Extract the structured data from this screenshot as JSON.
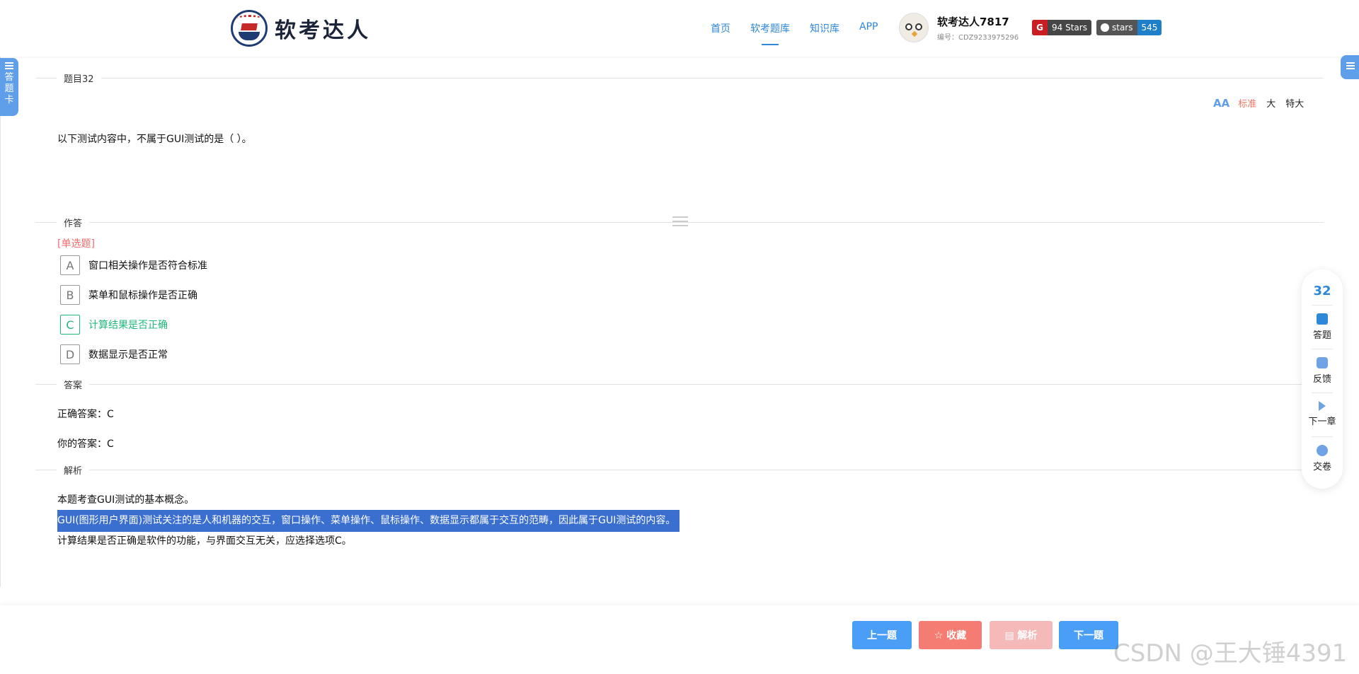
{
  "header": {
    "logo_text": "软考达人",
    "nav": [
      "首页",
      "软考题库",
      "知识库",
      "APP"
    ],
    "active_nav": "软考题库",
    "user_name": "软考达人7817",
    "user_id": "编号：CDZ9233975296",
    "gitee_badge": "94 Stars",
    "github_label": "stars",
    "github_count": "545"
  },
  "left_tab": {
    "label": "答题卡"
  },
  "question": {
    "section_label": "题目32",
    "font_sizes": [
      "标准",
      "大",
      "特大"
    ],
    "active_font_size": "标准",
    "text": "以下测试内容中，不属于GUI测试的是（ ）。"
  },
  "answer_section": {
    "label": "作答",
    "type": "[单选题]",
    "options": [
      {
        "key": "A",
        "text": "窗口相关操作是否符合标准"
      },
      {
        "key": "B",
        "text": "菜单和鼠标操作是否正确"
      },
      {
        "key": "C",
        "text": "计算结果是否正确"
      },
      {
        "key": "D",
        "text": "数据显示是否正常"
      }
    ]
  },
  "result_section": {
    "label": "答案",
    "correct": "正确答案：C",
    "yours": "你的答案：C"
  },
  "analysis_section": {
    "label": "解析",
    "lines": [
      "本题考查GUI测试的基本概念。",
      "GUI(图形用户界面)测试关注的是人和机器的交互，窗口操作、菜单操作、鼠标操作、数据显示都属于交互的范畴，因此属于GUI测试的内容。",
      "计算结果是否正确是软件的功能，与界面交互无关，应选择选项C。"
    ]
  },
  "float_panel": {
    "number": "32",
    "items": [
      "答题",
      "反馈",
      "下一章",
      "交卷"
    ]
  },
  "footer": {
    "prev": "上一题",
    "favorite": "☆ 收藏",
    "analysis": "▤ 解析",
    "next": "下一题"
  },
  "watermark": "CSDN @王大锤4391",
  "colors": {
    "accent": "#2f87d8",
    "correct": "#1fba7a",
    "danger": "#f26b6b",
    "highlight": "#3a6fd0"
  }
}
